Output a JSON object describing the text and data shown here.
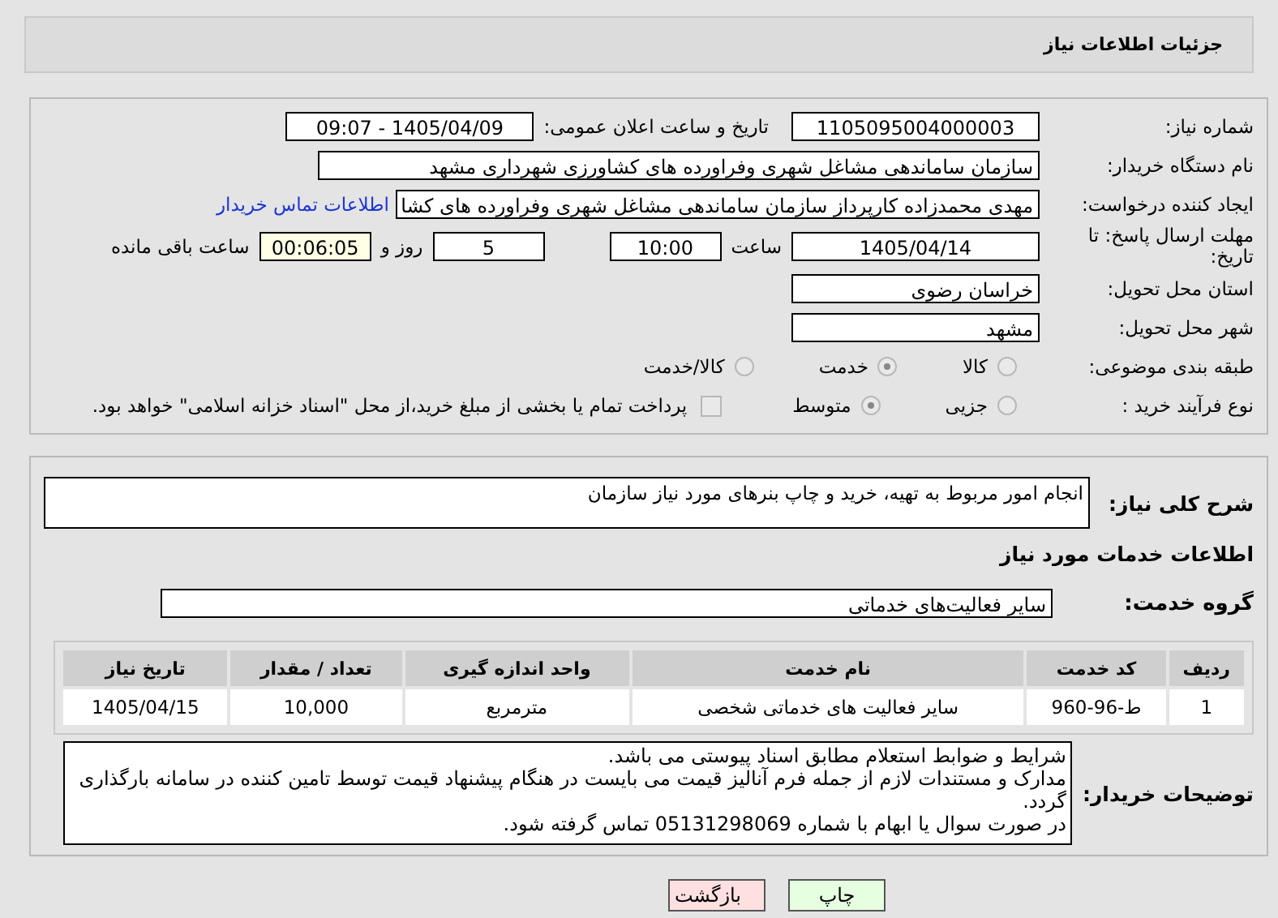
{
  "header": {
    "title": "جزئیات اطلاعات نیاز"
  },
  "details": {
    "need_number": {
      "label": "شماره نیاز:",
      "value": "1105095004000003"
    },
    "announce_date": {
      "label": "تاریخ و ساعت اعلان عمومی:",
      "value": "1405/04/09 - 09:07"
    },
    "buyer_org": {
      "label": "نام دستگاه خریدار:",
      "value": "سازمان ساماندهی مشاغل شهری وفراورده های کشاورزی شهرداری مشهد"
    },
    "requester": {
      "label": "ایجاد کننده درخواست:",
      "value": "مهدی محمدزاده کارپرداز سازمان ساماندهی مشاغل شهری وفراورده های کشا",
      "link": "اطلاعات تماس خریدار"
    },
    "deadline": {
      "label": "مهلت ارسال پاسخ: تا تاریخ:",
      "date": "1405/04/14",
      "time_label": "ساعت",
      "time": "10:00",
      "days": "5",
      "days_label": "روز و",
      "remaining": "00:06:05",
      "remaining_label": "ساعت باقی مانده"
    },
    "province": {
      "label": "استان محل تحویل:",
      "value": "خراسان رضوی"
    },
    "city": {
      "label": "شهر محل تحویل:",
      "value": "مشهد"
    },
    "category": {
      "label": "طبقه بندی موضوعی:",
      "options": [
        {
          "label": "کالا",
          "selected": false
        },
        {
          "label": "خدمت",
          "selected": true
        },
        {
          "label": "کالا/خدمت",
          "selected": false
        }
      ]
    },
    "purchase_type": {
      "label": "نوع فرآیند خرید :",
      "options": [
        {
          "label": "جزیی",
          "selected": false
        },
        {
          "label": "متوسط",
          "selected": true
        }
      ],
      "treasury": {
        "label": "پرداخت تمام یا بخشی از مبلغ خرید،از محل \"اسناد خزانه اسلامی\" خواهد بود.",
        "checked": false
      }
    }
  },
  "description": {
    "label": "شرح کلی نیاز:",
    "value": "انجام امور مربوط به تهیه، خرید و چاپ بنرهای مورد نیاز سازمان"
  },
  "services": {
    "heading": "اطلاعات خدمات مورد نیاز",
    "group": {
      "label": "گروه خدمت:",
      "value": "سایر فعالیت‌های خدماتی"
    },
    "table": {
      "columns": [
        "ردیف",
        "کد خدمت",
        "نام خدمت",
        "واحد اندازه گیری",
        "تعداد / مقدار",
        "تاریخ نیاز"
      ],
      "rows": [
        [
          "1",
          "ط-96-960",
          "سایر فعالیت های خدماتی شخصی",
          "مترمربع",
          "10,000",
          "1405/04/15"
        ]
      ]
    }
  },
  "buyer_notes": {
    "label": "توضیحات خریدار:",
    "paragraphs": [
      "شرایط و ضوابط استعلام مطابق اسناد پیوستی می باشد.",
      "مدارک و مستندات لازم از جمله فرم آنالیز قیمت می بایست در هنگام پیشنهاد قیمت توسط تامین کننده در سامانه بارگذاری گردد.",
      "در صورت سوال یا ابهام با شماره 05131298069 تماس گرفته شود."
    ]
  },
  "buttons": [
    {
      "label": "چاپ",
      "kind": "print"
    },
    {
      "label": "بازگشت",
      "kind": "back"
    }
  ]
}
